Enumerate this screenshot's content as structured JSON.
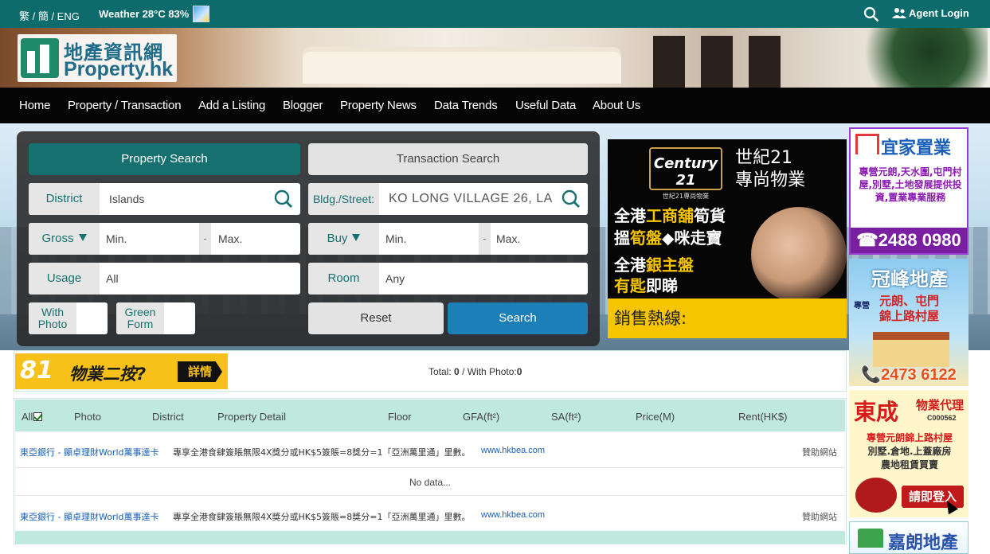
{
  "topbar": {
    "lang": "繁 / 簡 / ENG",
    "weather": "Weather 28°C 83%",
    "agent_login": "Agent Login"
  },
  "logo": {
    "zh": "地產資訊網",
    "en": "Property.hk"
  },
  "nav": [
    "Home",
    "Property / Transaction",
    "Add a Listing",
    "Blogger",
    "Property News",
    "Data Trends",
    "Useful Data",
    "About Us"
  ],
  "search": {
    "tab_property": "Property Search",
    "tab_transaction": "Transaction Search",
    "district_label": "District",
    "district_value": "Islands",
    "street_label": "Bldg./Street:",
    "street_value": "KO LONG VILLAGE 26, LA",
    "gross_label": "Gross",
    "gross_min": "Min.",
    "gross_max": "Max.",
    "buy_label": "Buy",
    "buy_min": "Min.",
    "buy_max": "Max.",
    "dash": "-",
    "usage_label": "Usage",
    "usage_value": "All",
    "room_label": "Room",
    "room_value": "Any",
    "with_photo": "With Photo",
    "green_form": "Green Form",
    "reset": "Reset",
    "search": "Search"
  },
  "ad_c21": {
    "logo_en": "Century 21",
    "logo_zh": "世紀21專尚物業",
    "brand_line1": "世紀21",
    "brand_line2": "專尚物業",
    "line1a": "全港",
    "line1b": "工商舖",
    "line1c": "筍貨",
    "line2a": "搵",
    "line2b": "筍盤",
    "line2c": "◆咪走寶",
    "line3a": "全港",
    "line3b": "銀主盤",
    "line4a": "有匙",
    "line4b": "即睇",
    "hotline": "銷售熱線:"
  },
  "ad_right": {
    "a1_title": "宜家置業",
    "a1_text": "專營元朗,天水圍,屯門村屋,別墅,土地發展提供投資,置業專業服務",
    "a1_phone": "☎2488 0980",
    "a2_title": "冠峰地產",
    "a2_pre": "專營",
    "a2_line1": "元朗、屯門",
    "a2_line2": "錦上路村屋",
    "a2_phone": "📞2473 6122",
    "a3_title": "東成",
    "a3_t2": "物業代理",
    "a3_code": "C000562",
    "a3_line1": "專營元朗錦上路村屋",
    "a3_line2": "別墅.倉地.上蓋廠房",
    "a3_line3": "農地租賃買賣",
    "a3_btn": "請即登入",
    "a4_title": "嘉朗地產"
  },
  "promo": {
    "logo": "81",
    "text": "物業二按?",
    "detail": "詳情",
    "total_label": "Total:",
    "total_value": "0",
    "photo_label": "/ With Photo:",
    "photo_value": "0"
  },
  "table": {
    "headers": [
      "All",
      "Photo",
      "District",
      "Property Detail",
      "Floor",
      "GFA(ft²)",
      "SA(ft²)",
      "Price(M)",
      "Rent(HK$)"
    ],
    "ad_link": "東亞銀行 - 顯卓理財World萬事達卡",
    "ad_desc": "專享全港食肆簽賬無限4X獎分或HK$5簽賬=8獎分=1「亞洲萬里通」里數。",
    "ad_url": "www.hkbea.com",
    "ad_sponsor": "贊助網站",
    "no_data": "No data..."
  }
}
